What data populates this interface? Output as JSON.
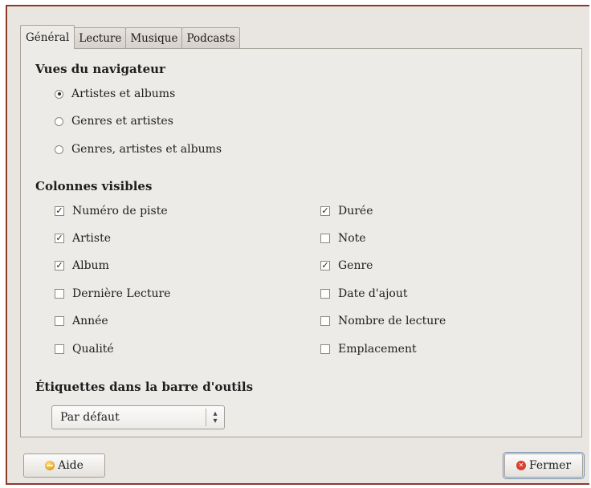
{
  "tabs": [
    {
      "label": "Général",
      "active": true
    },
    {
      "label": "Lecture",
      "active": false
    },
    {
      "label": "Musique",
      "active": false
    },
    {
      "label": "Podcasts",
      "active": false
    }
  ],
  "browser_views": {
    "title": "Vues du navigateur",
    "options": [
      {
        "label": "Artistes et albums",
        "selected": true
      },
      {
        "label": "Genres et artistes",
        "selected": false
      },
      {
        "label": "Genres, artistes et albums",
        "selected": false
      }
    ]
  },
  "visible_columns": {
    "title": "Colonnes visibles",
    "left": [
      {
        "label": "Numéro de piste",
        "checked": true
      },
      {
        "label": "Artiste",
        "checked": true
      },
      {
        "label": "Album",
        "checked": true
      },
      {
        "label": "Dernière Lecture",
        "checked": false
      },
      {
        "label": "Année",
        "checked": false
      },
      {
        "label": "Qualité",
        "checked": false
      }
    ],
    "right": [
      {
        "label": "Durée",
        "checked": true
      },
      {
        "label": "Note",
        "checked": false
      },
      {
        "label": "Genre",
        "checked": true
      },
      {
        "label": "Date d'ajout",
        "checked": false
      },
      {
        "label": "Nombre de lecture",
        "checked": false
      },
      {
        "label": "Emplacement",
        "checked": false
      }
    ]
  },
  "toolbar_labels": {
    "title": "Étiquettes dans la barre d'outils",
    "selected": "Par défaut"
  },
  "buttons": {
    "help": "Aide",
    "close": "Fermer"
  },
  "check_mark": "✓",
  "colors": {
    "window_border": "#8c3a2a",
    "background": "#e9e6e1",
    "panel": "#ecebe8"
  }
}
